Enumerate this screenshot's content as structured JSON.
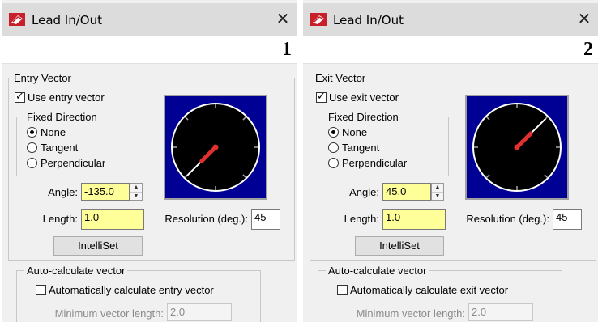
{
  "left": {
    "window_title": "Lead In/Out",
    "close": "✕",
    "step": "1",
    "group_title": "Entry Vector",
    "use_vector_label": "Use entry vector",
    "use_vector_checked": true,
    "fixed_direction_title": "Fixed Direction",
    "radio_none": "None",
    "radio_tangent": "Tangent",
    "radio_perpendicular": "Perpendicular",
    "selected_direction": "None",
    "angle_label": "Angle:",
    "angle_value": "-135.0",
    "length_label": "Length:",
    "length_value": "1.0",
    "resolution_label": "Resolution (deg.):",
    "resolution_value": "45",
    "intelliset_label": "IntelliSet",
    "auto_title": "Auto-calculate vector",
    "auto_checkbox_label": "Automatically calculate entry vector",
    "auto_checked": false,
    "min_length_label": "Minimum vector length:",
    "min_length_value": "2.0",
    "dial_angle_deg": -135
  },
  "right": {
    "window_title": "Lead In/Out",
    "close": "✕",
    "step": "2",
    "group_title": "Exit Vector",
    "use_vector_label": "Use exit vector",
    "use_vector_checked": true,
    "fixed_direction_title": "Fixed Direction",
    "radio_none": "None",
    "radio_tangent": "Tangent",
    "radio_perpendicular": "Perpendicular",
    "selected_direction": "None",
    "angle_label": "Angle:",
    "angle_value": "45.0",
    "length_label": "Length:",
    "length_value": "1.0",
    "resolution_label": "Resolution (deg.):",
    "resolution_value": "45",
    "intelliset_label": "IntelliSet",
    "auto_title": "Auto-calculate vector",
    "auto_checkbox_label": "Automatically calculate exit vector",
    "auto_checked": false,
    "min_length_label": "Minimum vector length:",
    "min_length_value": "2.0",
    "dial_angle_deg": 45
  },
  "colors": {
    "field_highlight": "#ffff99",
    "dial_background": "#000094",
    "needle": "#e03030"
  }
}
